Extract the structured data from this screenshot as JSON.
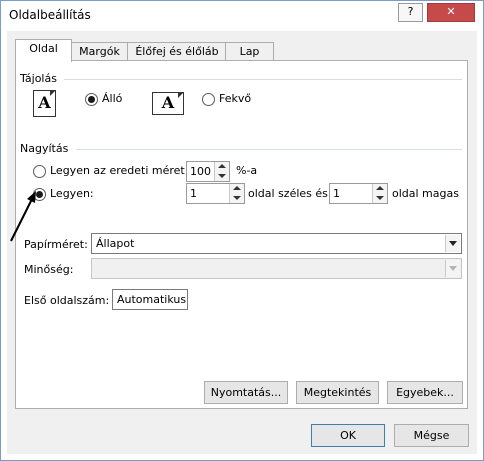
{
  "window": {
    "title": "Oldalbeállítás",
    "help_label": "?",
    "close_label": "✕"
  },
  "tabs": [
    {
      "label": "Oldal",
      "active": true
    },
    {
      "label": "Margók",
      "active": false
    },
    {
      "label": "Élőfej és élőláb",
      "active": false
    },
    {
      "label": "Lap",
      "active": false
    }
  ],
  "orientation": {
    "title": "Tájolás",
    "portrait_icon_letter": "A",
    "portrait_label": "Álló",
    "portrait_selected": true,
    "landscape_icon_letter": "A",
    "landscape_label": "Fekvő",
    "landscape_selected": false
  },
  "scaling": {
    "title": "Nagyítás",
    "adjust_label": "Legyen az eredeti méret:",
    "adjust_value": "100",
    "adjust_unit": "%-a",
    "fit_label": "Legyen:",
    "fit_wide_value": "1",
    "fit_wide_label": "oldal széles és",
    "fit_tall_value": "1",
    "fit_tall_label": "oldal magas",
    "fit_selected": true
  },
  "paper": {
    "paper_size_label": "Papírméret:",
    "paper_size_value": "Állapot",
    "quality_label": "Minőség:",
    "quality_value": "",
    "first_page_label": "Első oldalszám:",
    "first_page_value": "Automatikus"
  },
  "panel_buttons": {
    "print": "Nyomtatás...",
    "preview": "Megtekintés",
    "options": "Egyebek..."
  },
  "dialog_buttons": {
    "ok": "OK",
    "cancel": "Mégse"
  },
  "colors": {
    "accent_border": "#3c7fb1",
    "close_button": "#c74a4a"
  }
}
